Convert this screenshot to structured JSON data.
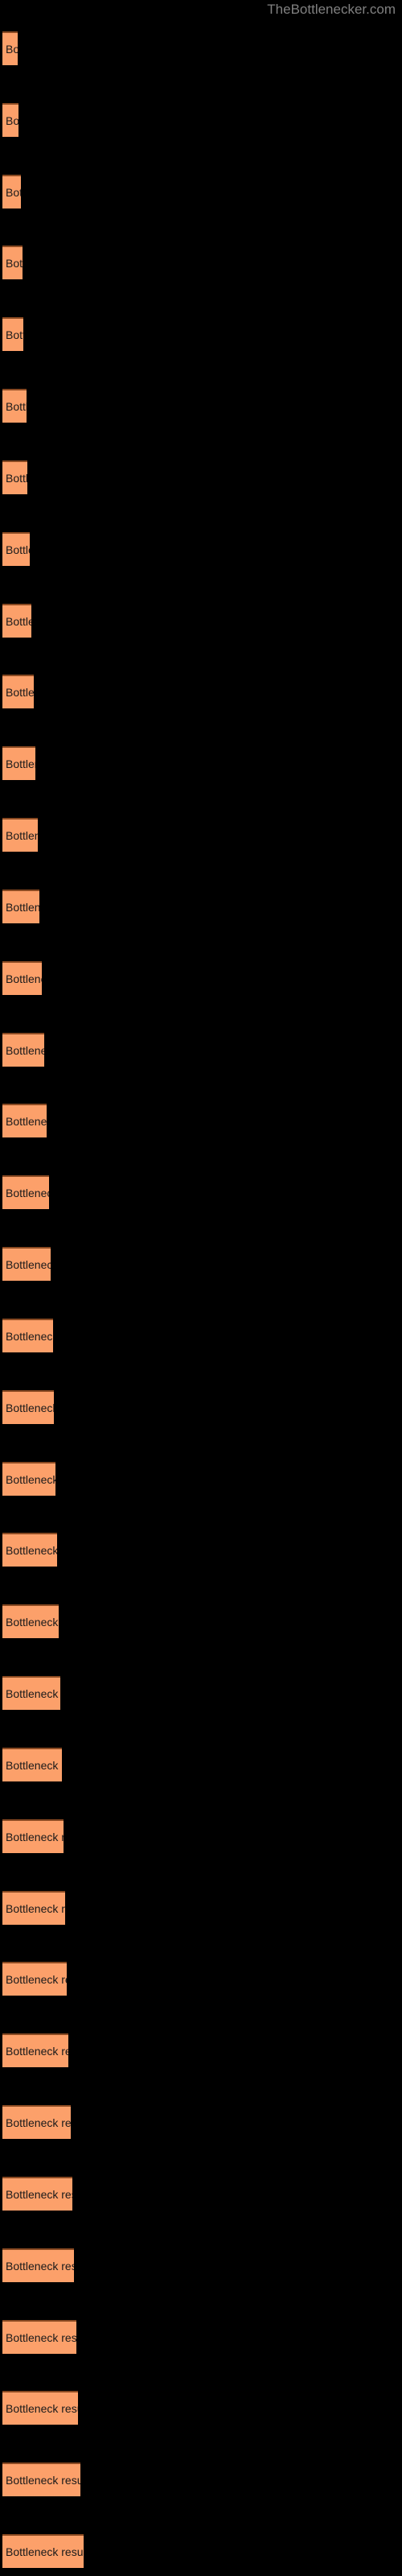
{
  "watermark": "TheBottlenecker.com",
  "chart_data": {
    "type": "bar",
    "orientation": "horizontal",
    "title": "",
    "subtitle": "",
    "xlabel": "",
    "ylabel": "",
    "grid": false,
    "legend": null,
    "background_color": "#000000",
    "bar_color": "#FCA06A",
    "bar_edge_color": "#8A4A22",
    "label_color": "#1A1A1A",
    "watermark_color": "#808080",
    "xlim": [
      0,
      105
    ],
    "bar_label": "Bottleneck result",
    "categories": [
      "Bottleneck result",
      "Bottleneck result",
      "Bottleneck result",
      "Bottleneck result",
      "Bottleneck result",
      "Bottleneck result",
      "Bottleneck result",
      "Bottleneck result",
      "Bottleneck result",
      "Bottleneck result",
      "Bottleneck result",
      "Bottleneck result",
      "Bottleneck result",
      "Bottleneck result",
      "Bottleneck result",
      "Bottleneck result",
      "Bottleneck result",
      "Bottleneck result",
      "Bottleneck result",
      "Bottleneck result",
      "Bottleneck result",
      "Bottleneck result",
      "Bottleneck result",
      "Bottleneck result",
      "Bottleneck result",
      "Bottleneck result",
      "Bottleneck result",
      "Bottleneck result",
      "Bottleneck result",
      "Bottleneck result",
      "Bottleneck result",
      "Bottleneck result",
      "Bottleneck result",
      "Bottleneck result",
      "Bottleneck result",
      "Bottleneck result"
    ],
    "values": [
      19,
      20,
      23,
      25,
      26,
      30,
      31,
      34,
      36,
      39,
      41,
      44,
      46,
      49,
      52,
      55,
      58,
      60,
      63,
      64,
      66,
      68,
      70,
      72,
      74,
      76,
      78,
      80,
      82,
      85,
      87,
      89,
      92,
      94,
      97,
      101
    ],
    "bar_count": 36
  }
}
